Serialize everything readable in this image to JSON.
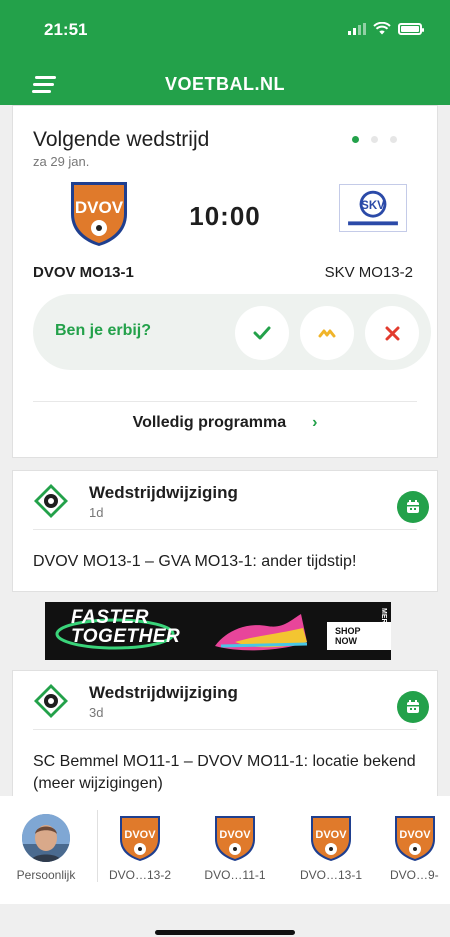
{
  "status_bar": {
    "time": "21:51"
  },
  "header": {
    "title": "VOETBAL.NL",
    "menu_icon": "hamburger-menu-icon"
  },
  "next_match": {
    "title": "Volgende wedstrijd",
    "date": "za 29 jan.",
    "time": "10:00",
    "home_team": "DVOV MO13-1",
    "away_team": "SKV MO13-2",
    "home_crest_text": "DVOV",
    "away_logo_text": "SKV",
    "pager": {
      "total": 3,
      "active": 1
    },
    "rsvp": {
      "question": "Ben je erbij?",
      "yes_icon": "checkmark-icon",
      "maybe_icon": "maybe-icon",
      "no_icon": "cross-icon"
    },
    "program_link": "Volledig programma"
  },
  "news": [
    {
      "title": "Wedstrijdwijziging",
      "age": "1d",
      "text": "DVOV MO13-1 – GVA MO13-1: ander tijdstip!"
    },
    {
      "title": "Wedstrijdwijziging",
      "age": "3d",
      "text": "SC Bemmel MO11-1 – DVOV MO11-1: locatie bekend (meer wijzigingen)"
    }
  ],
  "ad": {
    "headline_1": "FASTER",
    "headline_2": "TOGETHER",
    "button": "SHOP NOW",
    "brand": "MERCURIAL"
  },
  "teams_bar": {
    "items": [
      {
        "label": "Persoonlijk"
      },
      {
        "label": "DVO…13-2"
      },
      {
        "label": "DVO…11-1"
      },
      {
        "label": "DVO…13-1"
      },
      {
        "label": "DVO…9-"
      }
    ]
  },
  "colors": {
    "brand_green": "#23a14a",
    "maybe_orange": "#f0b429",
    "no_red": "#e23b2e",
    "crest_orange": "#e07a2b"
  }
}
